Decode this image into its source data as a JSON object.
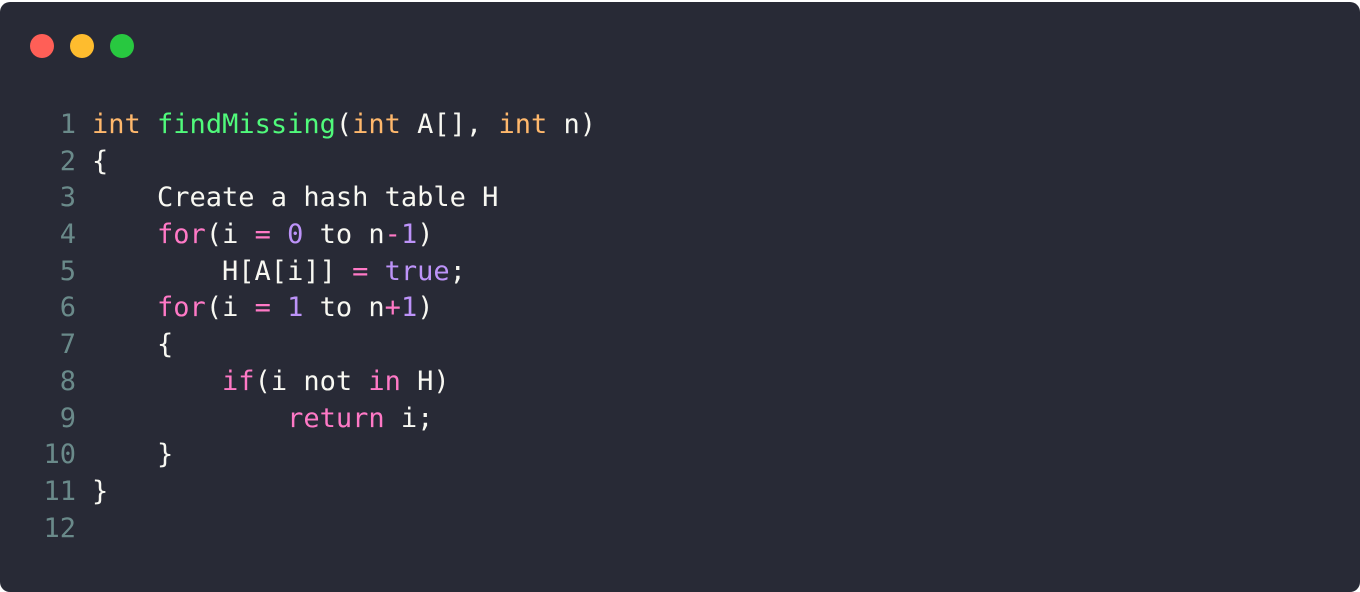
{
  "window": {
    "controls": [
      {
        "name": "close-dot",
        "color": "#ff5f57"
      },
      {
        "name": "minimize-dot",
        "color": "#febc2e"
      },
      {
        "name": "maximize-dot",
        "color": "#28c840"
      }
    ]
  },
  "colors": {
    "background": "#282a36",
    "type": "#ffb86c",
    "function": "#50fa7b",
    "keyword": "#ff79c6",
    "number": "#bd93f9",
    "text": "#f8f8f2",
    "line_number": "#6a8a8a"
  },
  "code": {
    "lines": [
      {
        "number": "1",
        "tokens": [
          {
            "t": "int",
            "c": "type"
          },
          {
            "t": " ",
            "c": "plain"
          },
          {
            "t": "findMissing",
            "c": "fn"
          },
          {
            "t": "(",
            "c": "plain"
          },
          {
            "t": "int",
            "c": "type"
          },
          {
            "t": " A[], ",
            "c": "plain"
          },
          {
            "t": "int",
            "c": "type"
          },
          {
            "t": " n)",
            "c": "plain"
          }
        ]
      },
      {
        "number": "2",
        "tokens": [
          {
            "t": "{",
            "c": "plain"
          }
        ]
      },
      {
        "number": "3",
        "tokens": [
          {
            "t": "    Create a hash table H",
            "c": "plain"
          }
        ]
      },
      {
        "number": "4",
        "tokens": [
          {
            "t": "    ",
            "c": "plain"
          },
          {
            "t": "for",
            "c": "kw"
          },
          {
            "t": "(i ",
            "c": "plain"
          },
          {
            "t": "=",
            "c": "op"
          },
          {
            "t": " ",
            "c": "plain"
          },
          {
            "t": "0",
            "c": "num"
          },
          {
            "t": " to n",
            "c": "plain"
          },
          {
            "t": "-",
            "c": "op"
          },
          {
            "t": "1",
            "c": "num"
          },
          {
            "t": ")",
            "c": "plain"
          }
        ]
      },
      {
        "number": "5",
        "tokens": [
          {
            "t": "        H[A[i]] ",
            "c": "plain"
          },
          {
            "t": "=",
            "c": "op"
          },
          {
            "t": " ",
            "c": "plain"
          },
          {
            "t": "true",
            "c": "num"
          },
          {
            "t": ";",
            "c": "plain"
          }
        ]
      },
      {
        "number": "6",
        "tokens": [
          {
            "t": "    ",
            "c": "plain"
          },
          {
            "t": "for",
            "c": "kw"
          },
          {
            "t": "(i ",
            "c": "plain"
          },
          {
            "t": "=",
            "c": "op"
          },
          {
            "t": " ",
            "c": "plain"
          },
          {
            "t": "1",
            "c": "num"
          },
          {
            "t": " to n",
            "c": "plain"
          },
          {
            "t": "+",
            "c": "op"
          },
          {
            "t": "1",
            "c": "num"
          },
          {
            "t": ")",
            "c": "plain"
          }
        ]
      },
      {
        "number": "7",
        "tokens": [
          {
            "t": "    {",
            "c": "plain"
          }
        ]
      },
      {
        "number": "8",
        "tokens": [
          {
            "t": "        ",
            "c": "plain"
          },
          {
            "t": "if",
            "c": "kw"
          },
          {
            "t": "(i not ",
            "c": "plain"
          },
          {
            "t": "in",
            "c": "kw"
          },
          {
            "t": " H)",
            "c": "plain"
          }
        ]
      },
      {
        "number": "9",
        "tokens": [
          {
            "t": "            ",
            "c": "plain"
          },
          {
            "t": "return",
            "c": "kw"
          },
          {
            "t": " i;",
            "c": "plain"
          }
        ]
      },
      {
        "number": "10",
        "tokens": [
          {
            "t": "    }",
            "c": "plain"
          }
        ]
      },
      {
        "number": "11",
        "tokens": [
          {
            "t": "}",
            "c": "plain"
          }
        ]
      },
      {
        "number": "12",
        "tokens": []
      }
    ]
  }
}
